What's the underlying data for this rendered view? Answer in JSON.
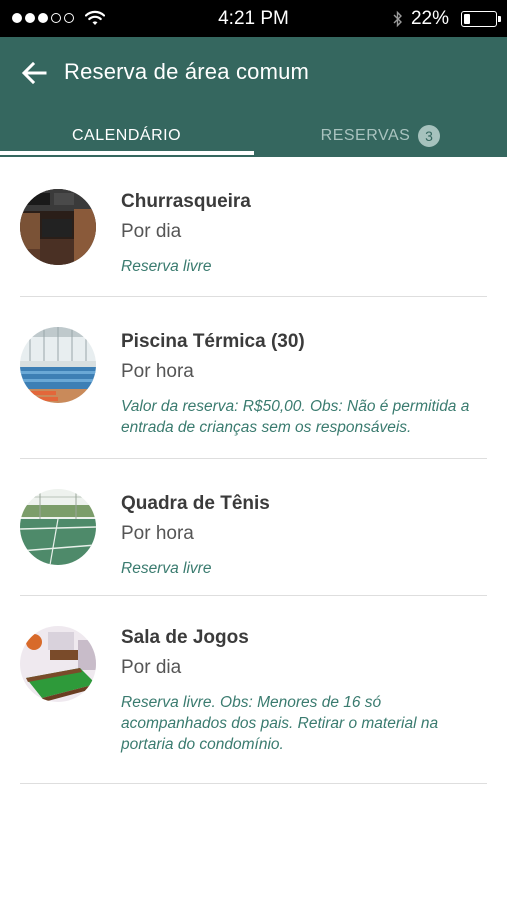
{
  "status_bar": {
    "time": "4:21 PM",
    "battery_text": "22%",
    "battery_level": 0.22
  },
  "header": {
    "title": "Reserva de área comum",
    "back_icon": "arrow-left-icon"
  },
  "tabs": [
    {
      "label": "CALENDÁRIO",
      "active": true
    },
    {
      "label": "RESERVAS",
      "active": false,
      "badge": "3"
    }
  ],
  "areas": [
    {
      "name": "Churrasqueira",
      "mode": "Por dia",
      "note": "Reserva livre",
      "image": "barbecue-area-photo"
    },
    {
      "name": "Piscina Térmica (30)",
      "mode": "Por hora",
      "note": "Valor da reserva: R$50,00. Obs: Não é permitida a entrada de crianças sem os responsáveis.",
      "image": "heated-pool-photo"
    },
    {
      "name": "Quadra de Tênis",
      "mode": "Por hora",
      "note": "Reserva livre",
      "image": "tennis-court-photo"
    },
    {
      "name": "Sala de Jogos",
      "mode": "Por dia",
      "note": "Reserva livre. Obs: Menores de 16 só acompanhados dos pais. Retirar o material na portaria do condomínio.",
      "image": "game-room-photo"
    }
  ],
  "colors": {
    "primary": "#35675f",
    "note_text": "#3a7b6f",
    "tab_inactive": "#a9c3bf"
  }
}
